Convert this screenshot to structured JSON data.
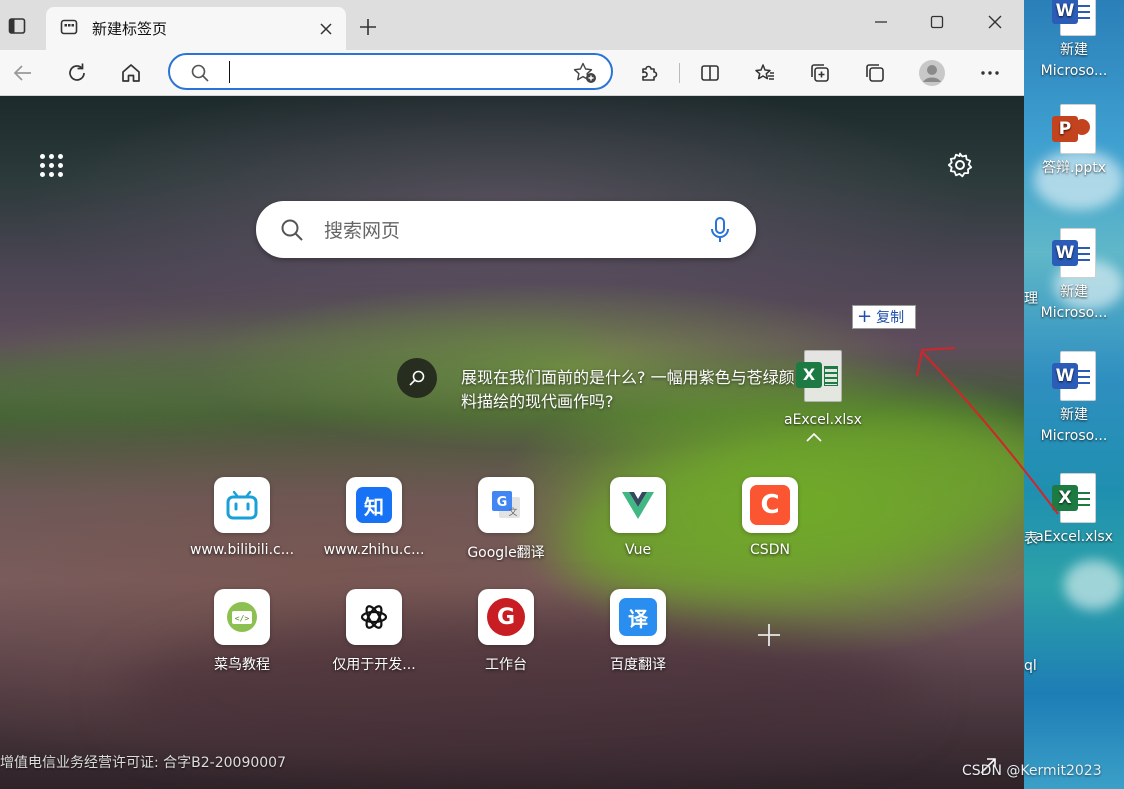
{
  "browser": {
    "tab": {
      "title": "新建标签页"
    },
    "address_bar": {
      "value": "",
      "placeholder": ""
    }
  },
  "new_tab_page": {
    "search": {
      "placeholder": "搜索网页"
    },
    "background_caption": "展现在我们面前的是什么? 一幅用紫色与苍绿颜料描绘的现代画作吗?",
    "quick_links": [
      {
        "label": "www.bilibili.c...",
        "icon": "bilibili-icon"
      },
      {
        "label": "www.zhihu.c...",
        "icon": "zhihu-icon",
        "glyph": "知"
      },
      {
        "label": "Google翻译",
        "icon": "google-translate-icon"
      },
      {
        "label": "Vue",
        "icon": "vue-icon"
      },
      {
        "label": "CSDN",
        "icon": "csdn-icon",
        "glyph": "C"
      },
      {
        "label": "菜鸟教程",
        "icon": "runoob-icon"
      },
      {
        "label": "仅用于开发...",
        "icon": "openai-icon"
      },
      {
        "label": "工作台",
        "icon": "gitee-icon",
        "glyph": "G"
      },
      {
        "label": "百度翻译",
        "icon": "baidu-translate-icon",
        "glyph": "译"
      }
    ],
    "license": "增值电信业务经营许可证: 合字B2-20090007"
  },
  "drag": {
    "file_name": "aExcel.xlsx",
    "badge_label": "复制"
  },
  "desktop": {
    "icons": [
      {
        "label": "新建",
        "label2": "Microso...",
        "type": "word"
      },
      {
        "label": "答辩.pptx",
        "type": "powerpoint"
      },
      {
        "label": "新建",
        "label2": "Microso...",
        "type": "word"
      },
      {
        "label": "新建",
        "label2": "Microso...",
        "type": "word"
      },
      {
        "label": "aExcel.xlsx",
        "type": "excel"
      }
    ],
    "side_text": {
      "a": "理",
      "b": "表",
      "c": "ql"
    }
  },
  "colors": {
    "word_blue": "#2b5cb8",
    "excel_green": "#1d7a43",
    "ppt_orange": "#c4431f",
    "accent_blue": "#2b73d6",
    "arrow_red": "#d0262a"
  },
  "watermark": "CSDN @Kermit2023"
}
